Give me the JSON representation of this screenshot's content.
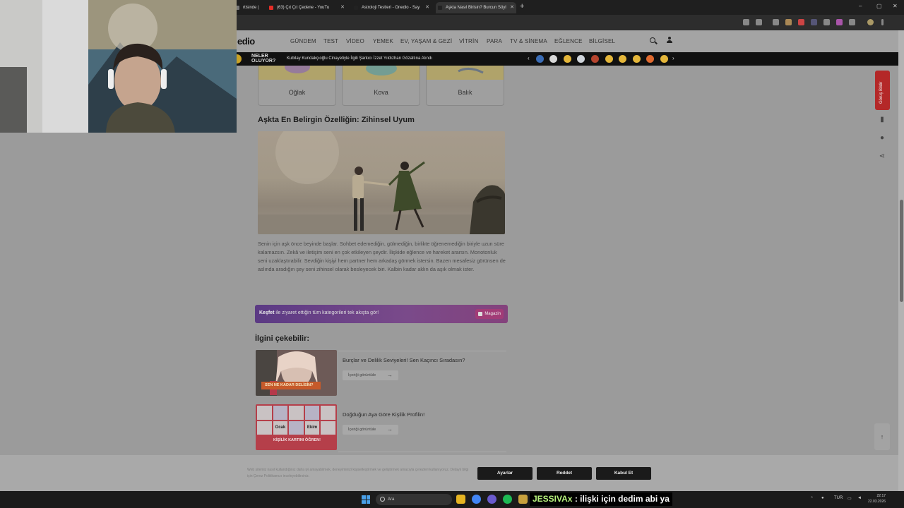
{
  "browser": {
    "tabs": [
      {
        "label": "rtisinde |",
        "favicon_color": "#777777"
      },
      {
        "label": "(63) Çıt Çıt Çedene - YouTu",
        "favicon_color": "#e52d27"
      },
      {
        "label": "Astroloji Testleri - Onedio - Say",
        "favicon_color": "#222222"
      },
      {
        "label": "Aşkta Nasıl Birisin? Burcun Söyl",
        "favicon_color": "#222222"
      }
    ],
    "new_tab": "+",
    "window_controls": {
      "minimize": "–",
      "maximize": "▢",
      "close": "✕"
    }
  },
  "site": {
    "logo": "edio",
    "nav": [
      "GÜNDEM",
      "TEST",
      "VİDEO",
      "YEMEK",
      "EV, YAŞAM & GEZİ",
      "VİTRİN",
      "PARA",
      "TV & SİNEMA",
      "EĞLENCE",
      "BİLGİSEL"
    ]
  },
  "ticker": {
    "label_line1": "NELER",
    "label_line2": "OLUYOR?",
    "headline": "Kubilay Kundakçıoğlu Cinayetiyle İlgili Şarkıcı İzzet Yıldızhan Gözaltına Alındı",
    "prev": "‹",
    "next": "›",
    "emoji_colors": [
      "#3a6cb5",
      "#d8d8d8",
      "#e4b63a",
      "#cfd4da",
      "#b5442e",
      "#e4b63a",
      "#e4b63a",
      "#e4b63a",
      "#e06a2f",
      "#e4b63a"
    ]
  },
  "zodiac_cards": [
    "Oğlak",
    "Kova",
    "Balık"
  ],
  "article": {
    "section_title": "Aşkta En Belirgin Özelliğin: Zihinsel Uyum",
    "body": "Senin için aşk önce beyinde başlar. Sohbet edemediğin, gülmediğin, birlikte öğrenemediğin biriyle uzun süre kalamazsın. Zekâ ve iletişim seni en çok etkileyen şeydir. İlişkide eğlence ve hareket ararsın. Monotonluk seni uzaklaştırabilir. Sevdiğin kişiyi hem partner hem arkadaş görmek istersin. Bazen mesafesiz görünsen de aslında aradığın şey seni zihinsel olarak besleyecek biri. Kalbin kadar aklın da aşık olmak ister."
  },
  "promo": {
    "highlight": "Keşfet",
    "text": " ile ziyaret ettiğin tüm kategorileri tek akışta gör!",
    "button": "Magazin"
  },
  "related": {
    "title": "İlgini çekebilir:",
    "items": [
      {
        "title": "Burçlar ve Delilik Seviyeleri! Sen Kaçıncı Sıradasın?",
        "button": "İçeriği görüntüle",
        "thumb_caption": "SEN NE KADAR DELİSİN?"
      },
      {
        "title": "Doğduğun Aya Göre Kişilik Profilin!",
        "button": "İçeriği görüntüle",
        "thumb_caption": "KİŞİLİK KARTINI ÖĞREN!"
      }
    ],
    "thumb2_cells": [
      "Ocak",
      "Ekim"
    ]
  },
  "sidebar": {
    "feedback": "Görüş Bildir",
    "scroll_top": "↑"
  },
  "cookie": {
    "text": "Web sitemiz nasıl kullandığınız daha iyi anlayabilmek, deneyiminizi kişiselleştirmek ve geliştirmek amacıyla çerezleri kullanıyoruz. Detaylı bilgi için Çerez Politikamızı inceleyebilirsiniz.",
    "buttons": [
      "Ayarlar",
      "Reddet",
      "Kabul Et"
    ]
  },
  "taskbar": {
    "search_placeholder": "Ara",
    "language": "TUR",
    "time": "22:17",
    "date": "22.03.2026",
    "app_colors": [
      "#e6b422",
      "#4285f4",
      "#6a5acd",
      "#1db954",
      "#c8a13d"
    ]
  },
  "chat": {
    "user": "JESSIVAx",
    "message": " : ilişki için dedim abi ya"
  }
}
